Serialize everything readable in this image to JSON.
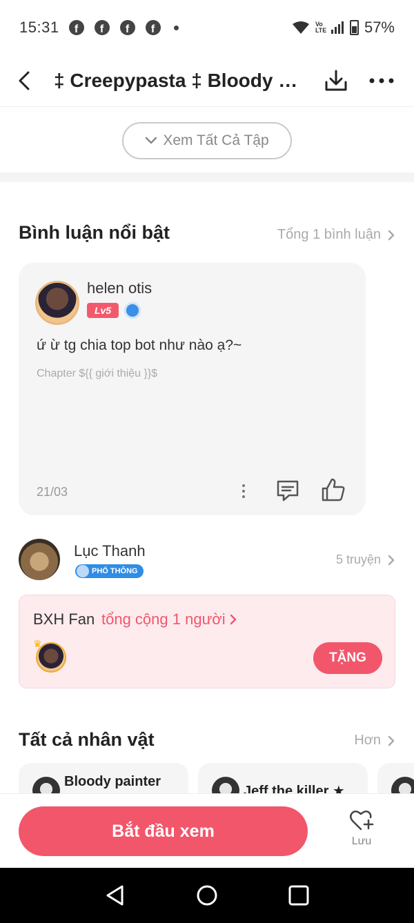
{
  "status_bar": {
    "time": "15:31",
    "notification_icons": [
      "facebook-icon",
      "facebook-icon",
      "facebook-icon",
      "facebook-icon"
    ],
    "network_label": "Vo LTE",
    "battery": "57%"
  },
  "header": {
    "title": "‡ Creepypasta ‡ Bloody Painter"
  },
  "episodes": {
    "view_all_label": "Xem Tất Cả Tập"
  },
  "comments": {
    "section_title": "Bình luận nổi bật",
    "total_label": "Tổng 1 bình luận",
    "items": [
      {
        "user": "helen otis",
        "level": "Lv5",
        "text": "ứ ừ tg chia top bot như nào ạ?~",
        "chapter": "Chapter ${{ giới thiệu }}$",
        "date": "21/03"
      }
    ]
  },
  "author": {
    "name": "Lục Thanh",
    "badge": "PHỔ THÔNG",
    "stories": "5 truyện"
  },
  "fan_ranking": {
    "title": "BXH Fan",
    "total": "tổng cộng 1 người",
    "gift_label": "TẶNG"
  },
  "characters": {
    "section_title": "Tất cả nhân vật",
    "more_label": "Hơn",
    "items": [
      {
        "name": "Bloody painter"
      },
      {
        "name": "Jeff the killer ★"
      }
    ]
  },
  "bottom_bar": {
    "start_label": "Bắt đầu xem",
    "save_label": "Lưu"
  },
  "colors": {
    "accent": "#f2566b",
    "fan_card_bg": "#fdebee",
    "badge_blue": "#2f8de6"
  }
}
